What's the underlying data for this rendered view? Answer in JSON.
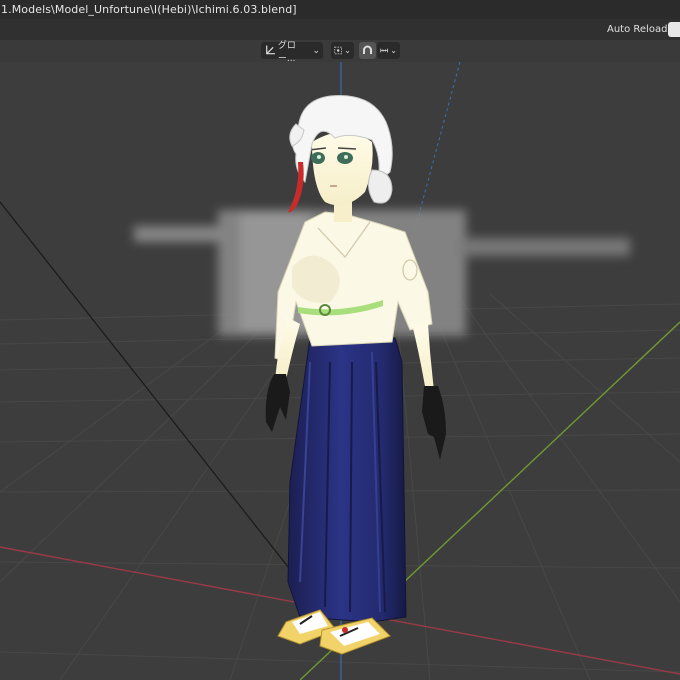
{
  "window": {
    "title": "1.Models\\Model_Unfortune\\I(Hebi)\\Ichimi.6.03.blend]"
  },
  "topbar": {
    "auto_reload_label": "Auto Reload"
  },
  "viewport_header": {
    "transform_orientation": "グロー...",
    "chevron": "⌄"
  },
  "colors": {
    "grid_line": "#474747",
    "x_axis": "#9b3a47",
    "y_axis": "#6e9a32",
    "z_axis": "#3c6fb0",
    "background": "#3d3d3d"
  }
}
